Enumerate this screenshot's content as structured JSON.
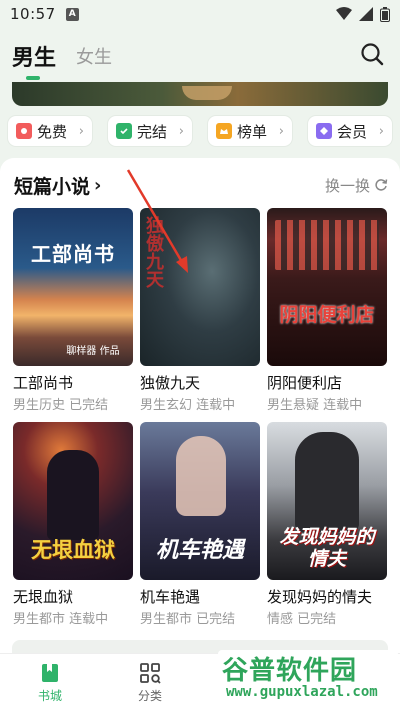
{
  "status": {
    "time": "10:57",
    "notif_letter": "A"
  },
  "header": {
    "tab_male": "男生",
    "tab_female": "女生"
  },
  "chips": [
    {
      "label": "免费",
      "icon": "free-icon",
      "color": "#f25c5c"
    },
    {
      "label": "完结",
      "icon": "finished-icon",
      "color": "#2fb36a"
    },
    {
      "label": "榜单",
      "icon": "ranking-icon",
      "color": "#f5a623"
    },
    {
      "label": "会员",
      "icon": "vip-icon",
      "color": "#8a6cf0"
    }
  ],
  "section": {
    "title": "短篇小说",
    "refresh_label": "换一换"
  },
  "books": [
    {
      "title": "工部尚书",
      "meta": "男生历史 已完结",
      "cover_text": "工部尚书",
      "cover_sub": "聊样器 作品"
    },
    {
      "title": "独傲九天",
      "meta": "男生玄幻 连载中",
      "cover_text": "独傲九天"
    },
    {
      "title": "阴阳便利店",
      "meta": "男生悬疑 连载中",
      "cover_text": "阴阳便利店"
    },
    {
      "title": "无垠血狱",
      "meta": "男生都市 连载中",
      "cover_text": "无垠血狱"
    },
    {
      "title": "机车艳遇",
      "meta": "男生都市 已完结",
      "cover_text": "机车艳遇"
    },
    {
      "title": "发现妈妈的情夫",
      "meta": "情感 已完结",
      "cover_text": "发现妈妈的情夫"
    }
  ],
  "nav": [
    {
      "label": "书城",
      "icon": "bookstore-icon",
      "active": true
    },
    {
      "label": "分类",
      "icon": "category-icon",
      "active": false
    }
  ],
  "watermark": {
    "title": "谷普软件园",
    "url": "www.gupuxlazal.com"
  },
  "colors": {
    "accent": "#2fb36a",
    "background": "#eef4ee"
  }
}
